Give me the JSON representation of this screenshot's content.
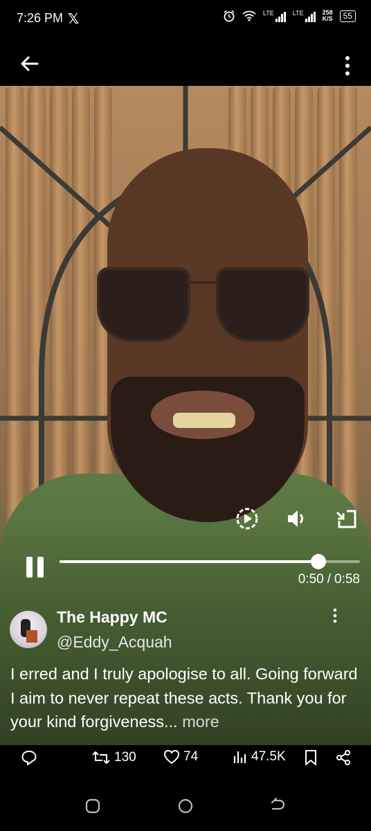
{
  "status_bar": {
    "time": "7:26 PM",
    "x_logo": "𝕏",
    "lte1": "LTE",
    "lte2": "LTE",
    "speed_value": "258",
    "speed_unit": "K/S",
    "battery": "55"
  },
  "media": {
    "progress_fraction": 0.862,
    "current_time": "0:50",
    "separator": "/",
    "duration": "0:58"
  },
  "tweet": {
    "display_name": "The Happy MC",
    "handle": "@Eddy_Acquah",
    "text": "I erred and I truly apologise to all. Going forward I aim to never repeat these acts. Thank you for your kind forgiveness...",
    "more_label": "more"
  },
  "actions": {
    "retweets": "130",
    "likes": "74",
    "views": "47.5K"
  },
  "icons": {
    "back": "back-arrow-icon",
    "overflow": "more-vertical-icon",
    "autoplay": "autoplay-icon",
    "volume": "volume-icon",
    "exit_fullscreen": "exit-fullscreen-icon",
    "reply": "reply-icon",
    "retweet": "retweet-icon",
    "like": "heart-icon",
    "views": "views-icon",
    "bookmark": "bookmark-icon",
    "share": "share-icon"
  }
}
